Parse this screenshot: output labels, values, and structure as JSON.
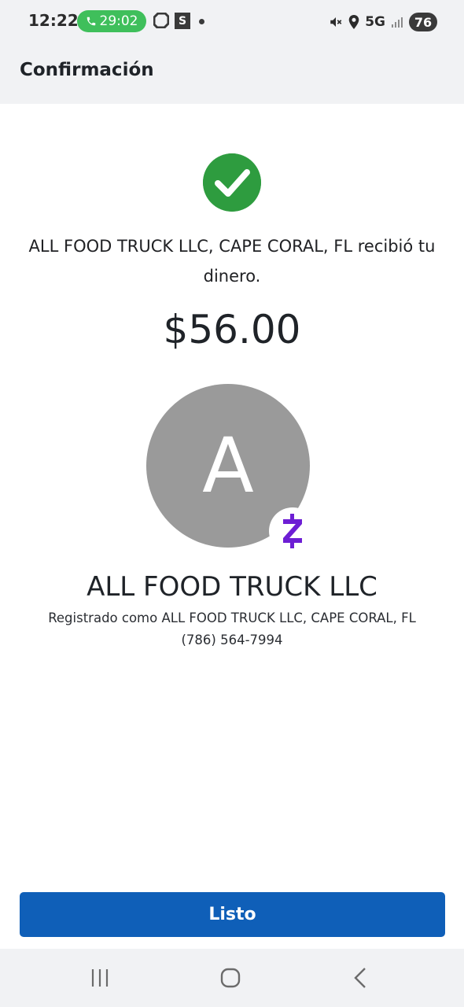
{
  "status_bar": {
    "time": "12:22",
    "call_timer": "29:02",
    "app_badge": "S",
    "network": "5G",
    "battery": "76"
  },
  "header": {
    "title": "Confirmación"
  },
  "confirmation": {
    "message": "ALL FOOD TRUCK LLC, CAPE CORAL, FL recibió tu dinero.",
    "amount": "$56.00",
    "success_color": "#2e9c3f"
  },
  "recipient": {
    "avatar_initial": "A",
    "name": "ALL FOOD TRUCK LLC",
    "registered_as": "Registrado como ALL FOOD TRUCK LLC, CAPE CORAL, FL",
    "phone": "(786) 564-7994",
    "payment_network_icon": "zelle-icon",
    "zelle_color": "#6d1ed4"
  },
  "actions": {
    "done_label": "Listo",
    "button_color": "#0f5fb8"
  },
  "nav_bar": {
    "icons": [
      "recent-apps-icon",
      "home-icon",
      "back-icon"
    ]
  }
}
